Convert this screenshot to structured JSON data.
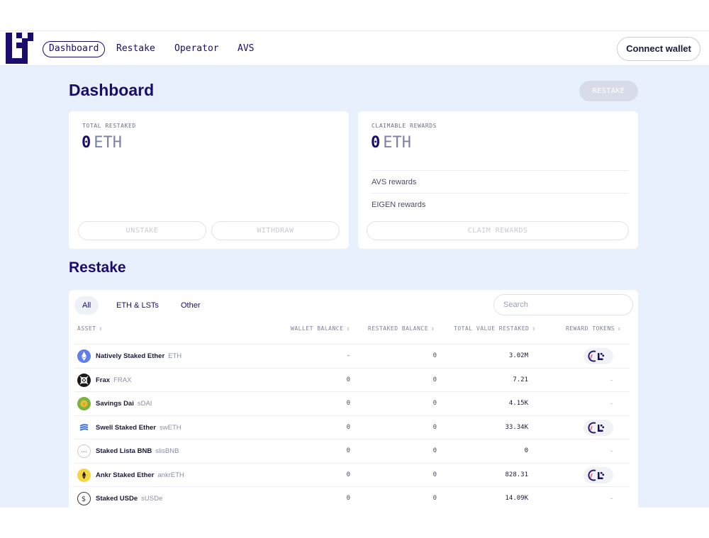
{
  "nav": {
    "items": [
      {
        "label": "Dashboard",
        "active": true
      },
      {
        "label": "Restake",
        "active": false
      },
      {
        "label": "Operator",
        "active": false
      },
      {
        "label": "AVS",
        "active": false
      }
    ],
    "connect_label": "Connect wallet"
  },
  "dashboard": {
    "title": "Dashboard",
    "restake_button": "RESTAKE",
    "total_restaked": {
      "label": "TOTAL RESTAKED",
      "value": "0",
      "unit": "ETH"
    },
    "claimable_rewards": {
      "label": "CLAIMABLE REWARDS",
      "value": "0",
      "unit": "ETH"
    },
    "unstake_button": "UNSTAKE",
    "withdraw_button": "WITHDRAW",
    "reward_rows": [
      "AVS rewards",
      "EIGEN rewards"
    ],
    "claim_button": "CLAIM REWARDS"
  },
  "restake": {
    "title": "Restake",
    "tabs": [
      "All",
      "ETH & LSTs",
      "Other"
    ],
    "search_placeholder": "Search",
    "columns": [
      "ASSET",
      "WALLET BALANCE",
      "RESTAKED BALANCE",
      "TOTAL VALUE RESTAKED",
      "REWARD TOKENS"
    ],
    "sort_glyph": "⇕",
    "rows": [
      {
        "name": "Natively Staked Ether",
        "symbol": "ETH",
        "wallet": "-",
        "restaked": "0",
        "total": "3.02M",
        "reward": "badge",
        "icon": "eth-icon",
        "color": "#627eea"
      },
      {
        "name": "Frax",
        "symbol": "FRAX",
        "wallet": "0",
        "restaked": "0",
        "total": "7.21",
        "reward": "-",
        "icon": "frax-icon",
        "color": "#1a1a1a"
      },
      {
        "name": "Savings Dai",
        "symbol": "sDAI",
        "wallet": "0",
        "restaked": "0",
        "total": "4.15K",
        "reward": "-",
        "icon": "sdai-icon",
        "color": "#7bb33d"
      },
      {
        "name": "Swell Staked Ether",
        "symbol": "swETH",
        "wallet": "0",
        "restaked": "0",
        "total": "33.34K",
        "reward": "badge",
        "icon": "sweth-icon",
        "color": "#3068ef"
      },
      {
        "name": "Staked Lista BNB",
        "symbol": "slisBNB",
        "wallet": "0",
        "restaked": "0",
        "total": "0",
        "reward": "-",
        "icon": "slisbnb-icon",
        "color": "#c9ccd6"
      },
      {
        "name": "Ankr Staked Ether",
        "symbol": "ankrETH",
        "wallet": "0",
        "restaked": "0",
        "total": "828.31",
        "reward": "badge",
        "icon": "ankreth-icon",
        "color": "#f5d63c"
      },
      {
        "name": "Staked USDe",
        "symbol": "sUSDe",
        "wallet": "0",
        "restaked": "0",
        "total": "14.09K",
        "reward": "-",
        "icon": "susde-icon",
        "color": "#3a3a3a"
      }
    ]
  }
}
